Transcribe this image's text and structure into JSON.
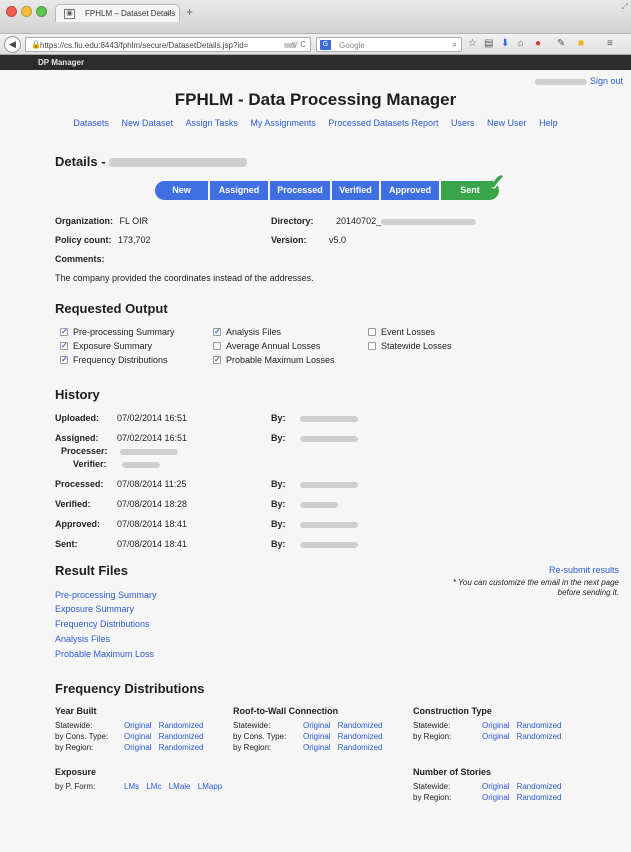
{
  "browser": {
    "tab_title": "FPHLM – Dataset Details",
    "tab_close": "×",
    "new_tab": "+",
    "url": "https://cs.fiu.edu:8443/fphlm/secure/DatasetDetails.jsp?id=",
    "url_controls": "▽ C",
    "search_placeholder": "Google",
    "search_engine_label": "G"
  },
  "appbar": {
    "title": "DP Manager"
  },
  "header": {
    "sign_out": "Sign out",
    "title": "FPHLM - Data Processing Manager"
  },
  "nav": [
    "Datasets",
    "New Dataset",
    "Assign Tasks",
    "My Assignments",
    "Processed Datasets Report",
    "Users",
    "New User",
    "Help"
  ],
  "details": {
    "heading": "Details - ",
    "steps": [
      "New",
      "Assigned",
      "Processed",
      "Verified",
      "Approved",
      "Sent"
    ],
    "organization_label": "Organization:",
    "organization": "FL OIR",
    "directory_label": "Directory:",
    "directory": "20140702_",
    "policy_label": "Policy count:",
    "policy_count": "173,702",
    "version_label": "Version:",
    "version": "v5.0",
    "comments_label": "Comments:",
    "comment": "The company provided the coordinates instead of the addresses."
  },
  "requested_output": {
    "heading": "Requested Output",
    "items": [
      {
        "label": "Pre-processing Summary",
        "checked": true
      },
      {
        "label": "Exposure Summary",
        "checked": true
      },
      {
        "label": "Frequency Distributions",
        "checked": true
      },
      {
        "label": "Analysis Files",
        "checked": true
      },
      {
        "label": "Average Annual Losses",
        "checked": false
      },
      {
        "label": "Probable Maximum Losses",
        "checked": true
      },
      {
        "label": "Event Losses",
        "checked": false
      },
      {
        "label": "Statewide Losses",
        "checked": false
      }
    ]
  },
  "history": {
    "heading": "History",
    "by_label": "By:",
    "processer_label": "Processer:",
    "verifier_label": "Verifier:",
    "rows": [
      {
        "label": "Uploaded:",
        "date": "07/02/2014 16:51"
      },
      {
        "label": "Assigned:",
        "date": "07/02/2014 16:51"
      },
      {
        "label": "Processed:",
        "date": "07/08/2014 11:25"
      },
      {
        "label": "Verified:",
        "date": "07/08/2014 18:28"
      },
      {
        "label": "Approved:",
        "date": "07/08/2014 18:41"
      },
      {
        "label": "Sent:",
        "date": "07/08/2014 18:41"
      }
    ]
  },
  "result_files": {
    "heading": "Result Files",
    "resubmit": "Re-submit results",
    "note": "* You can customize the email in the next page before sending it.",
    "links": [
      "Pre-processing Summary",
      "Exposure Summary",
      "Frequency Distributions",
      "Analysis Files",
      "Probable Maximum Loss"
    ]
  },
  "frequency": {
    "heading": "Frequency Distributions",
    "original": "Original",
    "randomized": "Randomized",
    "year_built": {
      "title": "Year Built",
      "rows": [
        "Statewide:",
        "by Cons. Type:",
        "by Region:"
      ]
    },
    "roof_to_wall": {
      "title": "Roof-to-Wall Connection",
      "rows": [
        "Statewide:",
        "by Cons. Type:",
        "by Region:"
      ]
    },
    "construction_type": {
      "title": "Construction Type",
      "rows": [
        "Statewide:",
        "by Region:"
      ]
    },
    "exposure": {
      "title": "Exposure",
      "row_label": "by P. Form:",
      "links": [
        "LMs",
        "LMc",
        "LMale",
        "LMapp"
      ]
    },
    "stories": {
      "title": "Number of Stories",
      "rows": [
        "Statewide:",
        "by Region:"
      ]
    }
  }
}
